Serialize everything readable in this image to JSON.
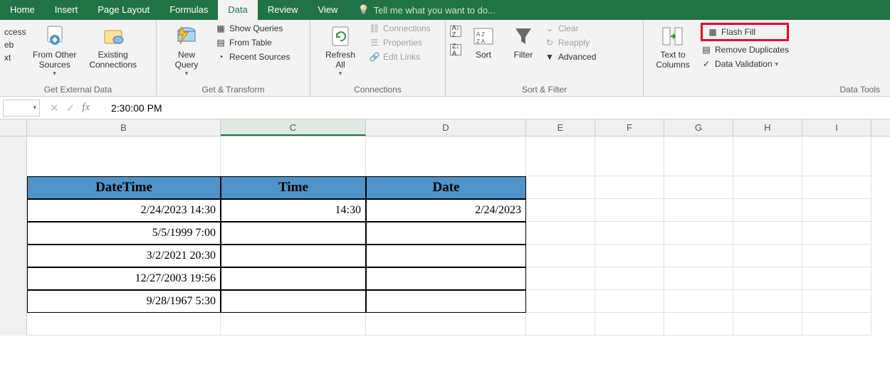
{
  "tabs": {
    "home": "Home",
    "insert": "Insert",
    "page_layout": "Page Layout",
    "formulas": "Formulas",
    "data": "Data",
    "review": "Review",
    "view": "View",
    "tellme": "Tell me what you want to do..."
  },
  "ribbon": {
    "g1": {
      "label": "Get External Data",
      "access_cut": "ccess",
      "web_cut": "eb",
      "text_cut": "xt",
      "from_other_sources": "From Other\nSources",
      "existing_connections": "Existing\nConnections"
    },
    "g2": {
      "label": "Get & Transform",
      "new_query": "New\nQuery",
      "show_queries": "Show Queries",
      "from_table": "From Table",
      "recent_sources": "Recent Sources"
    },
    "g3": {
      "label": "Connections",
      "refresh_all": "Refresh\nAll",
      "connections": "Connections",
      "properties": "Properties",
      "edit_links": "Edit Links"
    },
    "g4": {
      "label": "Sort & Filter",
      "sort": "Sort",
      "filter": "Filter",
      "clear": "Clear",
      "reapply": "Reapply",
      "advanced": "Advanced"
    },
    "g5": {
      "label": "Data Tools",
      "text_to_columns": "Text to\nColumns",
      "flash_fill": "Flash Fill",
      "remove_duplicates": "Remove Duplicates",
      "data_validation": "Data Validation"
    }
  },
  "formula_bar": {
    "value": "2:30:00 PM"
  },
  "cols": [
    "B",
    "C",
    "D",
    "E",
    "F",
    "G",
    "H",
    "I"
  ],
  "table": {
    "headers": {
      "b": "DateTime",
      "c": "Time",
      "d": "Date"
    },
    "rows": [
      {
        "b": "2/24/2023 14:30",
        "c": "14:30",
        "d": "2/24/2023"
      },
      {
        "b": "5/5/1999 7:00",
        "c": "",
        "d": ""
      },
      {
        "b": "3/2/2021 20:30",
        "c": "",
        "d": ""
      },
      {
        "b": "12/27/2003 19:56",
        "c": "",
        "d": ""
      },
      {
        "b": "9/28/1967 5:30",
        "c": "",
        "d": ""
      }
    ]
  }
}
